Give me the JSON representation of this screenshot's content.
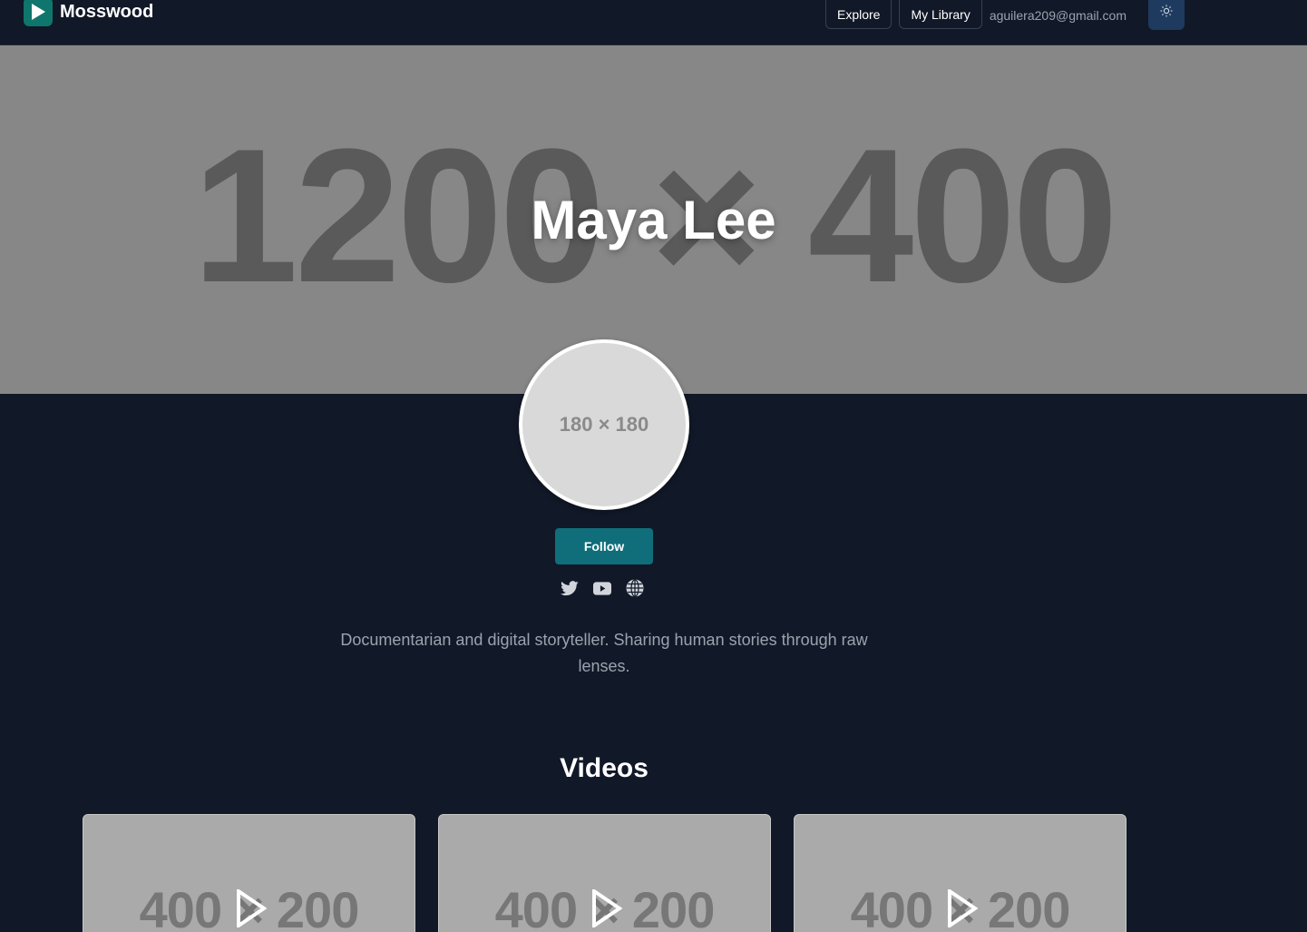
{
  "header": {
    "brand_name": "Mosswood",
    "nav": {
      "explore_label": "Explore",
      "library_label": "My Library",
      "user_email": "aguilera209@gmail.com"
    }
  },
  "banner": {
    "placeholder_text": "1200 × 400"
  },
  "profile": {
    "name": "Maya Lee",
    "avatar_placeholder": "180 × 180",
    "follow_label": "Follow",
    "bio": "Documentarian and digital storyteller. Sharing human stories through raw lenses.",
    "socials": [
      "twitter-icon",
      "youtube-icon",
      "globe-icon"
    ]
  },
  "videos": {
    "heading": "Videos",
    "items": [
      {
        "thumb_placeholder": "400 × 200"
      },
      {
        "thumb_placeholder": "400 × 200"
      },
      {
        "thumb_placeholder": "400 × 200"
      }
    ]
  },
  "colors": {
    "background": "#111827",
    "accent": "#0f6e7a",
    "brand": "#0f766e",
    "muted_text": "#9ca3af"
  }
}
